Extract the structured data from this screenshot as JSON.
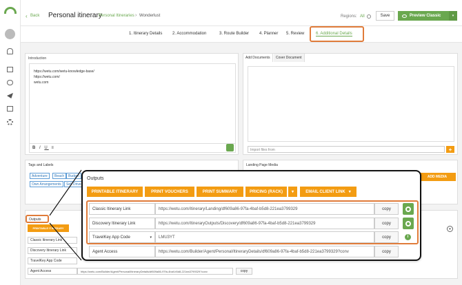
{
  "header": {
    "back": "Back",
    "title": "Personal itinerary",
    "crumb_active": "Personal Itineraries",
    "crumb_sep": "›",
    "crumb_current": "Wonderlust",
    "regions_label": "Regions:",
    "regions_value": "All",
    "save": "Save",
    "preview": "Preview Classic"
  },
  "steps": [
    "1. Itinerary Details",
    "2. Accommodation",
    "3. Route Builder",
    "4. Planner",
    "5. Review",
    "6. Additional Details"
  ],
  "intro": {
    "label": "Introduction",
    "lines": [
      "https://wetu.com/wetu-knowledge-base/",
      "https://wetu.com/",
      "wetu.com"
    ]
  },
  "docs": {
    "tab1": "Add Documents",
    "tab2": "Cover Document",
    "import_placeholder": "Import files from",
    "add": "+"
  },
  "tags": {
    "label": "Tags and Labels",
    "items": [
      "Adventure",
      "Beach",
      "Budget",
      "Own Arrangements",
      "Self Drive"
    ]
  },
  "landing": {
    "label": "Landing Page Media",
    "add_media": "ADD MEDIA"
  },
  "small_outputs": {
    "label": "Outputs",
    "btn": "PRINTABLE ITINERARY",
    "rows": [
      "Classic Itinerary Link",
      "Discovery Itinerary Link",
      "TravelKey App Code",
      "Agent Access"
    ],
    "agent_url": "https://wetu.com/Builder/Agent/Personal/ItineraryDetails/df609a86-97fa-4baf-b5d8-221ea3799329?conv",
    "copy": "copy"
  },
  "outputs": {
    "title": "Outputs",
    "buttons": [
      "PRINTABLE ITINERARY",
      "PRINT VOUCHERS",
      "PRINT SUMMARY",
      "PRICING (RACK)",
      "EMAIL CLIENT LINK"
    ],
    "rows": [
      {
        "label": "Classic Itinerary Link",
        "value": "https://wetu.com/Itinerary/Landing/df609a86-97fa-4baf-b5d8-221ea3799329",
        "copy": "copy"
      },
      {
        "label": "Discovery Itinerary Link",
        "value": "https://wetu.com/ItineraryOutputs/Discovery/df609a86-97fa-4baf-b5d8-221ea3799329",
        "copy": "copy"
      },
      {
        "label": "TravelKey App Code",
        "value": "LMU3YT",
        "copy": "copy"
      },
      {
        "label": "Agent Access",
        "value": "https://wetu.com/Builder/Agent/Personal/ItineraryDetails/df609a86-97fa-4baf-b5d8-221ea3799329?conv",
        "copy": "copy"
      }
    ]
  },
  "colors": {
    "accent": "#e07b39",
    "green": "#6aa84f",
    "orange": "#f39c12"
  }
}
